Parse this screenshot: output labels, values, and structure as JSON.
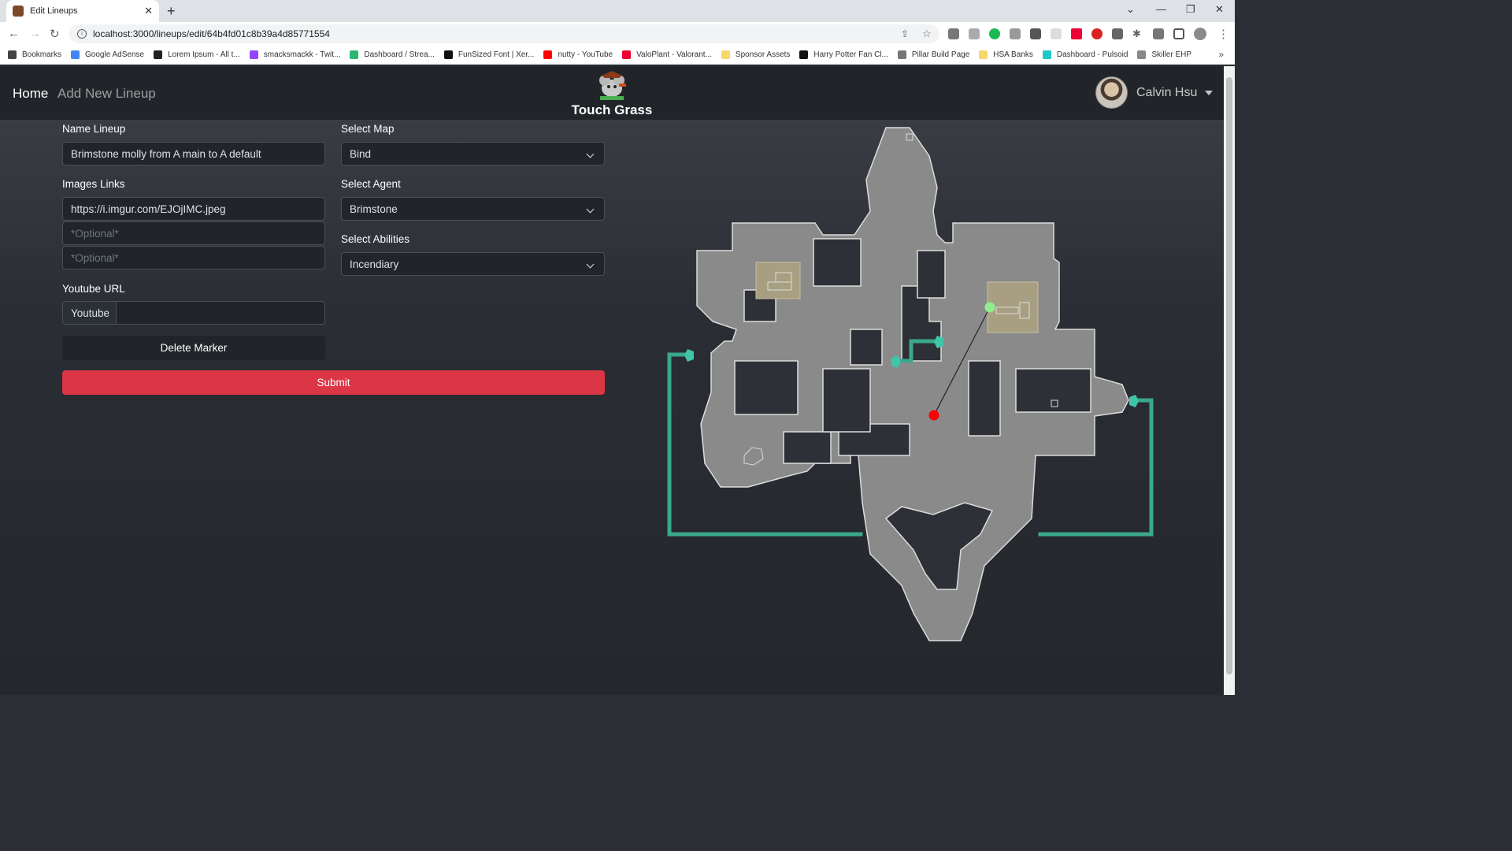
{
  "browser": {
    "tab_title": "Edit Lineups",
    "url": "localhost:3000/lineups/edit/64b4fd01c8b39a4d85771554",
    "bookmarks": [
      {
        "label": "Bookmarks",
        "color": "#444"
      },
      {
        "label": "Google AdSense",
        "color": "#4285f4"
      },
      {
        "label": "Lorem Ipsum - All t...",
        "color": "#222"
      },
      {
        "label": "smacksmackk - Twit...",
        "color": "#9146ff"
      },
      {
        "label": "Dashboard / Strea...",
        "color": "#2bb673"
      },
      {
        "label": "FunSized Font | Xer...",
        "color": "#111"
      },
      {
        "label": "nutty - YouTube",
        "color": "#ff0000"
      },
      {
        "label": "ValoPlant - Valorant...",
        "color": "#e03"
      },
      {
        "label": "Sponsor Assets",
        "color": "#f6d76b"
      },
      {
        "label": "Harry Potter Fan Cl...",
        "color": "#111"
      },
      {
        "label": "Pillar Build Page",
        "color": "#777"
      },
      {
        "label": "HSA Banks",
        "color": "#f6d76b"
      },
      {
        "label": "Dashboard - Pulsoid",
        "color": "#1ec8c8"
      },
      {
        "label": "Skiller EHP",
        "color": "#888"
      }
    ],
    "more": "»"
  },
  "navbar": {
    "home": "Home",
    "add_new": "Add New Lineup",
    "brand": "Touch Grass",
    "user_name": "Calvin Hsu"
  },
  "form": {
    "name_label": "Name Lineup",
    "name_value": "Brimstone molly from A main to A default",
    "images_label": "Images Links",
    "image_1": "https://i.imgur.com/EJOjIMC.jpeg",
    "image_placeholder": "*Optional*",
    "youtube_label": "Youtube URL",
    "youtube_prefix": "Youtube",
    "youtube_value": "",
    "map_label": "Select Map",
    "map_value": "Bind",
    "agent_label": "Select Agent",
    "agent_value": "Brimstone",
    "abilities_label": "Select Abilities",
    "abilities_value": "Incendiary",
    "delete_button": "Delete Marker",
    "submit_button": "Submit"
  },
  "map": {
    "name": "Bind",
    "floor_color": "#8a8a8a",
    "site_color": "#a89f82",
    "teleporter_color": "#3aa88c",
    "start_marker_color": "#90ee90",
    "end_marker_color": "#ff0000"
  }
}
